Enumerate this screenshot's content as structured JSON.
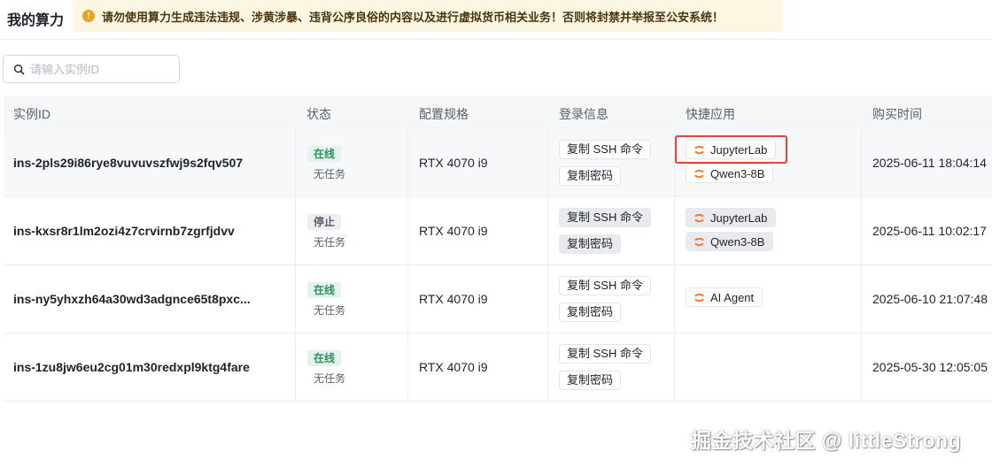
{
  "header": {
    "title": "我的算力",
    "warning": "请勿使用算力生成违法违规、涉黄涉暴、违背公序良俗的内容以及进行虚拟货币相关业务！否则将封禁并举报至公安系统！"
  },
  "search": {
    "placeholder": "请输入实例ID",
    "value": ""
  },
  "table": {
    "columns": [
      "实例ID",
      "状态",
      "配置规格",
      "登录信息",
      "快捷应用",
      "购买时间"
    ],
    "rows": [
      {
        "id": "ins-2pls29i86rye8vuvuvszfwj9s2fqv507",
        "status": "在线",
        "task": "无任务",
        "spec": "RTX 4070 i9",
        "login": [
          "复制 SSH 命令",
          "复制密码"
        ],
        "apps": [
          "JupyterLab",
          "Qwen3-8B"
        ],
        "time": "2025-06-11 18:04:14"
      },
      {
        "id": "ins-kxsr8r1lm2ozi4z7crvirnb7zgrfjdvv",
        "status": "停止",
        "task": "无任务",
        "spec": "RTX 4070 i9",
        "login": [
          "复制 SSH 命令",
          "复制密码"
        ],
        "apps": [
          "JupyterLab",
          "Qwen3-8B"
        ],
        "time": "2025-06-11 10:02:17"
      },
      {
        "id": "ins-ny5yhxzh64a30wd3adgnce65t8pxc...",
        "status": "在线",
        "task": "无任务",
        "spec": "RTX 4070 i9",
        "login": [
          "复制 SSH 命令",
          "复制密码"
        ],
        "apps": [
          "AI Agent"
        ],
        "time": "2025-06-10 21:07:48"
      },
      {
        "id": "ins-1zu8jw6eu2cg01m30redxpl9ktg4fare",
        "status": "在线",
        "task": "无任务",
        "spec": "RTX 4070 i9",
        "login": [
          "复制 SSH 命令",
          "复制密码"
        ],
        "apps": [],
        "time": "2025-05-30 12:05:05"
      }
    ]
  },
  "watermark": "掘金技术社区 @ littleStrong",
  "colors": {
    "accent_highlight": "#e0453b",
    "online_tag": "#2f8f5b",
    "warning_bg": "#fdf6e3",
    "jupyter_orange": "#f37726"
  },
  "icons": {
    "search": "search-icon",
    "warning": "warning-icon",
    "app": "jupyter-icon"
  }
}
